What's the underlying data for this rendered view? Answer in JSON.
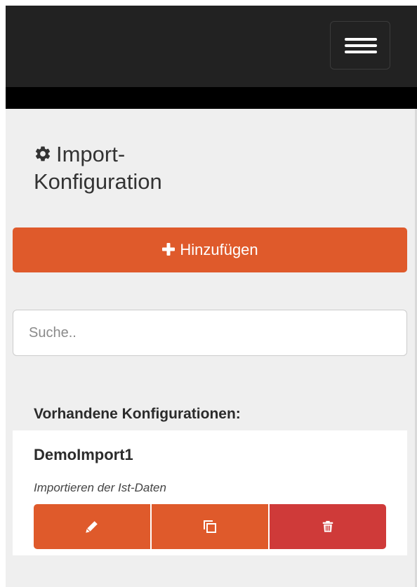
{
  "navbar": {
    "menu_toggle_icon": "hamburger-menu-icon"
  },
  "page": {
    "title_icon": "gear-icon",
    "title": "Import-Konfiguration"
  },
  "actions": {
    "add_icon": "plus-icon",
    "add_label": "Hinzufügen"
  },
  "search": {
    "placeholder": "Suche..",
    "value": ""
  },
  "configs": {
    "heading": "Vorhandene Konfigurationen:",
    "items": [
      {
        "name": "DemoImport1",
        "description": "Importieren der Ist-Daten",
        "buttons": [
          {
            "icon": "pencil-icon",
            "purpose": "edit"
          },
          {
            "icon": "copy-icon",
            "purpose": "copy"
          },
          {
            "icon": "trash-icon",
            "purpose": "delete"
          }
        ]
      }
    ]
  },
  "colors": {
    "navbar": "#222222",
    "navbar_strip": "#000000",
    "page_background": "#efefef",
    "primary_orange": "#df5a2b",
    "danger_red": "#cf3a39",
    "text": "#333333"
  }
}
